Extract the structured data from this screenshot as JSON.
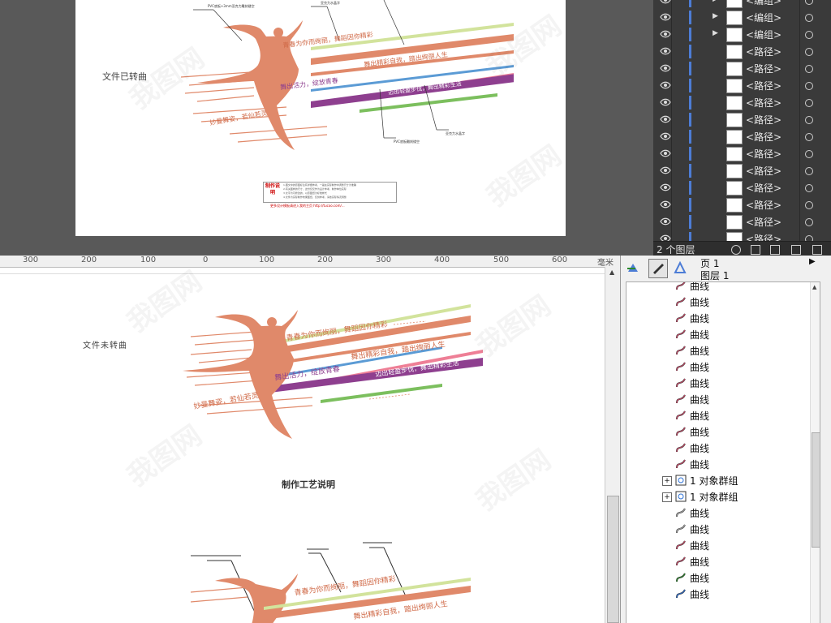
{
  "illustrator": {
    "label_converted": "文件已转曲",
    "slogans": [
      "青春为你而绚丽，舞蹈因你精彩",
      "舞出精彩自我，踏出绚丽人生",
      "舞出活力，绽放青春",
      "迈出轻盈步伐，舞出精彩生活",
      "妙曼舞姿，若仙若灵"
    ],
    "callout_top_left": "PVC底板+3mm亚克力雕刻镂空",
    "callout_top_mid": "亚克力水晶字",
    "callout_bottom_left": "PVC底板雕刻镂空",
    "callout_bottom_right": "亚克力水晶字",
    "note_title": "制作说明",
    "note_lines": [
      "1.图文中的原图标注有详细参考，一般在实际制作中调整尺寸为准确",
      "2.有关图样的尺寸，这份仅仅作为设计参考，制作单位实际",
      "3.文字为可修改的，以原图纸为标准样式",
      "4.文件为实际制作效果图纸，仅供参考，请依实际情况调整"
    ],
    "note_link": "更多设计模板请进入我的主页 http://tucoo.com/..."
  },
  "layers_panel": {
    "rows": [
      {
        "name": "<编组>",
        "has_arrow": true
      },
      {
        "name": "<编组>",
        "has_arrow": true
      },
      {
        "name": "<编组>",
        "has_arrow": true
      },
      {
        "name": "<路径>",
        "has_arrow": false
      },
      {
        "name": "<路径>",
        "has_arrow": false
      },
      {
        "name": "<路径>",
        "has_arrow": false
      },
      {
        "name": "<路径>",
        "has_arrow": false
      },
      {
        "name": "<路径>",
        "has_arrow": false
      },
      {
        "name": "<路径>",
        "has_arrow": false
      },
      {
        "name": "<路径>",
        "has_arrow": false
      },
      {
        "name": "<路径>",
        "has_arrow": false
      },
      {
        "name": "<路径>",
        "has_arrow": false
      },
      {
        "name": "<路径>",
        "has_arrow": false
      },
      {
        "name": "<路径>",
        "has_arrow": false
      },
      {
        "name": "<路径>",
        "has_arrow": false
      }
    ],
    "layer_count": "2 个图层"
  },
  "corel": {
    "ruler_ticks": [
      "300",
      "200",
      "100",
      "0",
      "100",
      "200",
      "300",
      "400",
      "500",
      "600"
    ],
    "ruler_unit": "毫米",
    "label_unconverted": "文件未转曲",
    "heading": "制作工艺说明",
    "slogans": [
      "青春为你而绚丽，舞蹈因你精彩",
      "舞出精彩自我，踏出绚丽人生",
      "舞出活力，绽放青春",
      "迈出轻盈步伐，舞出精彩生活",
      "妙曼舞姿，若仙若灵"
    ]
  },
  "object_manager": {
    "page": "页 1",
    "layer": "图层 1",
    "items": [
      "曲线",
      "曲线",
      "曲线",
      "曲线",
      "曲线",
      "曲线",
      "曲线",
      "曲线",
      "曲线",
      "曲线",
      "曲线",
      "曲线",
      "1 对象群组",
      "1 对象群组",
      "曲线",
      "曲线",
      "曲线",
      "曲线",
      "曲线",
      "曲线"
    ]
  },
  "colors": {
    "dancer": "#e0896a",
    "purple": "#8e3f8f",
    "green": "#7cbf5e",
    "light_green": "#d2e39c",
    "pink": "#ee7f96",
    "blue": "#5b9bd5",
    "layer_bar": "#4d7dd6"
  }
}
